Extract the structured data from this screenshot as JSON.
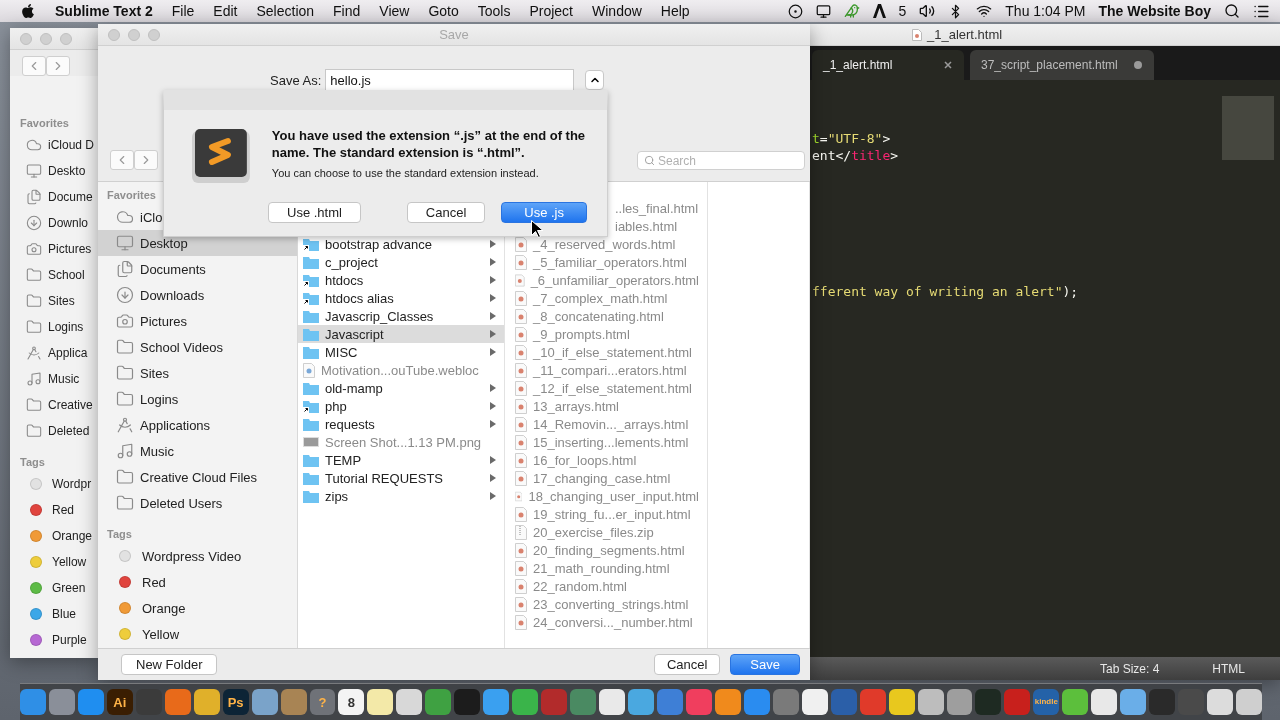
{
  "menu_bar": {
    "app_name": "Sublime Text 2",
    "menus": [
      "File",
      "Edit",
      "Selection",
      "Find",
      "View",
      "Goto",
      "Tools",
      "Project",
      "Window",
      "Help"
    ],
    "badge_count": "5",
    "clock": "Thu 1:04 PM",
    "user": "The Website Boy"
  },
  "finder_window": {
    "favorites_header": "Favorites",
    "favorites": [
      {
        "label": "iCloud D",
        "kind": "cloud"
      },
      {
        "label": "Deskto",
        "kind": "desktop"
      },
      {
        "label": "Docume",
        "kind": "documents"
      },
      {
        "label": "Downlo",
        "kind": "downloads"
      },
      {
        "label": "Pictures",
        "kind": "pictures"
      },
      {
        "label": "School",
        "kind": "folder"
      },
      {
        "label": "Sites",
        "kind": "folder"
      },
      {
        "label": "Logins",
        "kind": "folder"
      },
      {
        "label": "Applica",
        "kind": "applications"
      },
      {
        "label": "Music",
        "kind": "music"
      },
      {
        "label": "Creative",
        "kind": "folder"
      },
      {
        "label": "Deleted",
        "kind": "folder"
      }
    ],
    "tags_header": "Tags",
    "tags": [
      {
        "label": "Wordpr",
        "color": "#e2e2e2"
      },
      {
        "label": "Red",
        "color": "#e0443e"
      },
      {
        "label": "Orange",
        "color": "#f09a37"
      },
      {
        "label": "Yellow",
        "color": "#eecd3b"
      },
      {
        "label": "Green",
        "color": "#5dbb46"
      },
      {
        "label": "Blue",
        "color": "#3ba7e8"
      },
      {
        "label": "Purple",
        "color": "#b668d3"
      }
    ]
  },
  "save_dialog": {
    "title": "Save",
    "save_as_label": "Save As:",
    "file_name": "hello.js",
    "search": {
      "placeholder": "Search"
    },
    "sidebar": {
      "favorites_header": "Favorites",
      "favorites": [
        {
          "label": "iClo",
          "kind": "cloud",
          "selected": false
        },
        {
          "label": "Desktop",
          "kind": "desktop",
          "selected": true
        },
        {
          "label": "Documents",
          "kind": "documents",
          "selected": false
        },
        {
          "label": "Downloads",
          "kind": "downloads",
          "selected": false
        },
        {
          "label": "Pictures",
          "kind": "pictures",
          "selected": false
        },
        {
          "label": "School Videos",
          "kind": "folder",
          "selected": false
        },
        {
          "label": "Sites",
          "kind": "folder",
          "selected": false
        },
        {
          "label": "Logins",
          "kind": "folder",
          "selected": false
        },
        {
          "label": "Applications",
          "kind": "applications",
          "selected": false
        },
        {
          "label": "Music",
          "kind": "music",
          "selected": false
        },
        {
          "label": "Creative Cloud Files",
          "kind": "folder",
          "selected": false
        },
        {
          "label": "Deleted Users",
          "kind": "folder",
          "selected": false
        }
      ],
      "tags_header": "Tags",
      "tags": [
        {
          "label": "Wordpress Video",
          "color": "#e2e2e2"
        },
        {
          "label": "Red",
          "color": "#e0443e"
        },
        {
          "label": "Orange",
          "color": "#f09a37"
        },
        {
          "label": "Yellow",
          "color": "#eecd3b"
        }
      ]
    },
    "columns": [
      [
        {
          "name": "bootstrap advance",
          "kind": "alias-folder",
          "selected": false,
          "disabled": false
        },
        {
          "name": "c_project",
          "kind": "folder",
          "selected": false,
          "disabled": false
        },
        {
          "name": "htdocs",
          "kind": "alias-folder",
          "selected": false,
          "disabled": false
        },
        {
          "name": "htdocs alias",
          "kind": "alias-folder",
          "selected": false,
          "disabled": false
        },
        {
          "name": "Javascrip_Classes",
          "kind": "folder",
          "selected": false,
          "disabled": false
        },
        {
          "name": "Javascript",
          "kind": "folder",
          "selected": true,
          "disabled": false
        },
        {
          "name": "MISC",
          "kind": "folder",
          "selected": false,
          "disabled": false
        },
        {
          "name": "Motivation...ouTube.webloc",
          "kind": "webloc",
          "selected": false,
          "disabled": true
        },
        {
          "name": "old-mamp",
          "kind": "folder",
          "selected": false,
          "disabled": false
        },
        {
          "name": "php",
          "kind": "alias-folder",
          "selected": false,
          "disabled": false
        },
        {
          "name": "requests",
          "kind": "folder",
          "selected": false,
          "disabled": false
        },
        {
          "name": "Screen Shot...1.13 PM.png",
          "kind": "image",
          "selected": false,
          "disabled": true
        },
        {
          "name": "TEMP",
          "kind": "folder",
          "selected": false,
          "disabled": false
        },
        {
          "name": "Tutorial REQUESTS",
          "kind": "folder",
          "selected": false,
          "disabled": false
        },
        {
          "name": "zips",
          "kind": "folder",
          "selected": false,
          "disabled": false
        }
      ],
      [
        {
          "name": "..les_final.html",
          "kind": "clipped",
          "selected": false,
          "disabled": true
        },
        {
          "name": "iables.html",
          "kind": "clipped",
          "selected": false,
          "disabled": true
        },
        {
          "name": "_4_reserved_words.html",
          "kind": "html",
          "selected": false,
          "disabled": true
        },
        {
          "name": "_5_familiar_operators.html",
          "kind": "html",
          "selected": false,
          "disabled": true
        },
        {
          "name": "_6_unfamiliar_operators.html",
          "kind": "html",
          "selected": false,
          "disabled": true
        },
        {
          "name": "_7_complex_math.html",
          "kind": "html",
          "selected": false,
          "disabled": true
        },
        {
          "name": "_8_concatenating.html",
          "kind": "html",
          "selected": false,
          "disabled": true
        },
        {
          "name": "_9_prompts.html",
          "kind": "html",
          "selected": false,
          "disabled": true
        },
        {
          "name": "_10_if_else_statement.html",
          "kind": "html",
          "selected": false,
          "disabled": true
        },
        {
          "name": "_11_compari...erators.html",
          "kind": "html",
          "selected": false,
          "disabled": true
        },
        {
          "name": "_12_if_else_statement.html",
          "kind": "html",
          "selected": false,
          "disabled": true
        },
        {
          "name": "13_arrays.html",
          "kind": "html",
          "selected": false,
          "disabled": true
        },
        {
          "name": "14_Removin..._arrays.html",
          "kind": "html",
          "selected": false,
          "disabled": true
        },
        {
          "name": "15_inserting...lements.html",
          "kind": "html",
          "selected": false,
          "disabled": true
        },
        {
          "name": "16_for_loops.html",
          "kind": "html",
          "selected": false,
          "disabled": true
        },
        {
          "name": "17_changing_case.html",
          "kind": "html",
          "selected": false,
          "disabled": true
        },
        {
          "name": "18_changing_user_input.html",
          "kind": "html",
          "selected": false,
          "disabled": true
        },
        {
          "name": "19_string_fu...er_input.html",
          "kind": "html",
          "selected": false,
          "disabled": true
        },
        {
          "name": "20_exercise_files.zip",
          "kind": "zip",
          "selected": false,
          "disabled": true
        },
        {
          "name": "20_finding_segments.html",
          "kind": "html",
          "selected": false,
          "disabled": true
        },
        {
          "name": "21_math_rounding.html",
          "kind": "html",
          "selected": false,
          "disabled": true
        },
        {
          "name": "22_random.html",
          "kind": "html",
          "selected": false,
          "disabled": true
        },
        {
          "name": "23_converting_strings.html",
          "kind": "html",
          "selected": false,
          "disabled": true
        },
        {
          "name": "24_conversi..._number.html",
          "kind": "html",
          "selected": false,
          "disabled": true
        }
      ]
    ],
    "new_folder_button": "New Folder",
    "buttons": [
      {
        "label": "Cancel",
        "default": false
      },
      {
        "label": "Save",
        "default": true
      }
    ]
  },
  "alert": {
    "heading": "You have used the extension “.js” at the end of the name. The standard extension is “.html”.",
    "message": "You can choose to use the standard extension instead.",
    "buttons": [
      {
        "label": "Use .html",
        "default": false
      },
      {
        "label": "Cancel",
        "default": false
      },
      {
        "label": "Use .js",
        "default": true
      }
    ]
  },
  "editor": {
    "window_title": "_1_alert.html",
    "tabs": [
      {
        "label": "_1_alert.html",
        "selected": true,
        "modified": false
      },
      {
        "label": "37_script_placement.html",
        "selected": false,
        "modified": true
      }
    ],
    "lines": [
      {
        "kind": "blank"
      },
      {
        "kind": "blank"
      },
      {
        "kind": "code",
        "tokens": [
          {
            "text": "t",
            "kind": "attr"
          },
          {
            "text": "=",
            "kind": "plain"
          },
          {
            "text": "\"UTF-8\"",
            "kind": "string"
          },
          {
            "text": ">",
            "kind": "plain"
          }
        ]
      },
      {
        "kind": "code",
        "tokens": [
          {
            "text": "ent</",
            "kind": "plain"
          },
          {
            "text": "title",
            "kind": "tag"
          },
          {
            "text": ">",
            "kind": "plain"
          }
        ]
      },
      {
        "kind": "blank"
      },
      {
        "kind": "blank"
      },
      {
        "kind": "blank"
      },
      {
        "kind": "blank"
      },
      {
        "kind": "blank"
      },
      {
        "kind": "blank"
      },
      {
        "kind": "blank"
      },
      {
        "kind": "code",
        "tokens": [
          {
            "text": "fferent way of writing an alert\"",
            "kind": "string"
          },
          {
            "text": ");",
            "kind": "plain"
          }
        ]
      }
    ],
    "status_bar": {
      "tab_size": "Tab Size: 4",
      "syntax": "HTML"
    }
  },
  "dock": {
    "apps": [
      {
        "color": "#2f8fe6"
      },
      {
        "color": "#8a8f99"
      },
      {
        "color": "#1f8ef0"
      },
      {
        "color": "#3a1e02",
        "label": "Ai"
      },
      {
        "color": "#3b3b3b"
      },
      {
        "color": "#e86a1a"
      },
      {
        "color": "#e0b02a"
      },
      {
        "color": "#0d2436",
        "label": "Ps"
      },
      {
        "color": "#7aa3c9"
      },
      {
        "color": "#a88454"
      },
      {
        "color": "#6f7278",
        "label": "?"
      },
      {
        "color": "#f4f4f4",
        "label": "8"
      },
      {
        "color": "#f3e9a8"
      },
      {
        "color": "#d8d8d8"
      },
      {
        "color": "#3fa142"
      },
      {
        "color": "#1c1c1c"
      },
      {
        "color": "#3aa0f0"
      },
      {
        "color": "#3ab44a"
      },
      {
        "color": "#b22b2b"
      },
      {
        "color": "#4a8a62"
      },
      {
        "color": "#e9e9e9"
      },
      {
        "color": "#4aa8e0"
      },
      {
        "color": "#3e7fd6"
      },
      {
        "color": "#f03e5e"
      },
      {
        "color": "#f08a1c"
      },
      {
        "color": "#2a8cf0"
      },
      {
        "color": "#7a7a7a"
      },
      {
        "color": "#f0f0f0"
      },
      {
        "color": "#2b5fa8"
      },
      {
        "color": "#e03a2a"
      },
      {
        "color": "#e8c81e"
      },
      {
        "color": "#bdbdbd"
      },
      {
        "color": "#9e9e9e"
      },
      {
        "color": "#1e2a22"
      },
      {
        "color": "#c8201c"
      },
      {
        "color": "#2462a8",
        "label": "kindle"
      },
      {
        "color": "#5cbf3c"
      },
      {
        "color": "#e8e8e8"
      },
      {
        "color": "#6aaee8"
      },
      {
        "color": "#2a2a2a"
      },
      {
        "color": "#4a4a4a"
      },
      {
        "color": "#dcdcdc"
      },
      {
        "color": "#cfcfcf"
      }
    ]
  }
}
